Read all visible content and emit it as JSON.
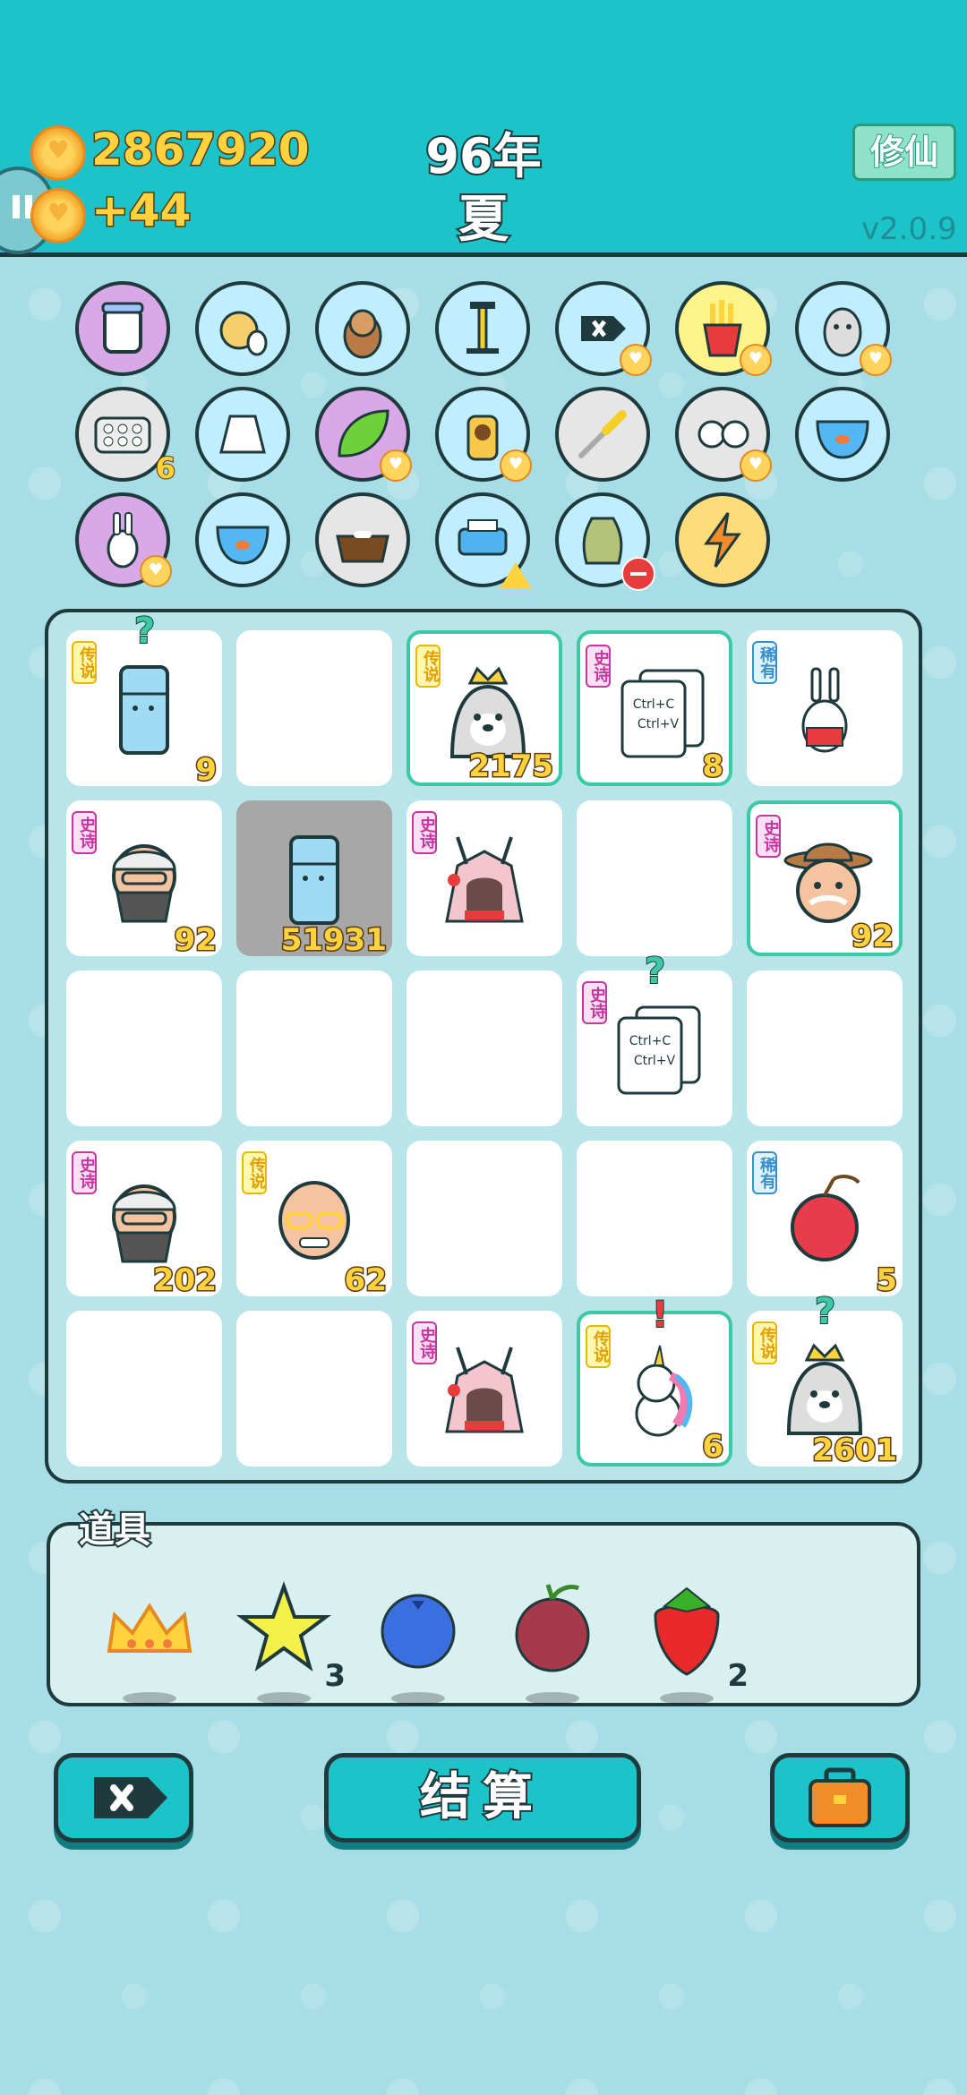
{
  "header": {
    "coins": "2867920",
    "coins_rate": "+44",
    "year": "96年",
    "season": "夏",
    "xiuxian_button": "修仙",
    "version": "v2.0.9"
  },
  "inventory_icons": [
    {
      "name": "jar-icon",
      "bg": "#d9a8e6"
    },
    {
      "name": "chick-egg-icon",
      "bg": "#bfefff"
    },
    {
      "name": "dog-icon",
      "bg": "#bfefff"
    },
    {
      "name": "air-pump-icon",
      "bg": "#bfefff"
    },
    {
      "name": "delete-tag-icon",
      "bg": "#bfefff"
    },
    {
      "name": "fries-icon",
      "bg": "#fff48a"
    },
    {
      "name": "husky-icon",
      "bg": "#bfefff"
    },
    {
      "name": "egg-tray-icon",
      "bg": "#e6e6e6",
      "count": "6"
    },
    {
      "name": "skirt-icon",
      "bg": "#bfefff"
    },
    {
      "name": "leaf-icon",
      "bg": "#d9a8e6"
    },
    {
      "name": "cat-icon",
      "bg": "#bfefff"
    },
    {
      "name": "screwdriver-icon",
      "bg": "#e6e6e6"
    },
    {
      "name": "cows-icon",
      "bg": "#e6e6e6"
    },
    {
      "name": "fish-bowl-icon",
      "bg": "#bfefff"
    },
    {
      "name": "rabbit-icon",
      "bg": "#d9a8e6"
    },
    {
      "name": "fish-bowl-icon",
      "bg": "#bfefff"
    },
    {
      "name": "pet-food-icon",
      "bg": "#e6e6e6"
    },
    {
      "name": "printer-icon",
      "bg": "#bfefff"
    },
    {
      "name": "trash-bag-icon",
      "bg": "#bfefff"
    },
    {
      "name": "lightning-icon",
      "bg": "#ffdc7a"
    }
  ],
  "board": [
    {
      "rarity": "传说",
      "type": "legend",
      "item": "fridge",
      "count": "9",
      "mark": "?"
    },
    {},
    {
      "rarity": "传说",
      "type": "legend",
      "item": "husky-crown",
      "count": "2175",
      "highlight": true
    },
    {
      "rarity": "史诗",
      "type": "epic",
      "item": "copy-paste",
      "count": "8",
      "highlight": true
    },
    {
      "rarity": "稀有",
      "type": "rare",
      "item": "rabbit-red"
    },
    {
      "rarity": "史诗",
      "type": "epic",
      "item": "old-man",
      "count": "92"
    },
    {
      "item": "fridge",
      "count": "51931",
      "dark": true
    },
    {
      "rarity": "史诗",
      "type": "epic",
      "item": "rabbit-house"
    },
    {},
    {
      "rarity": "史诗",
      "type": "epic",
      "item": "cowboy",
      "count": "92",
      "highlight": true
    },
    {},
    {},
    {},
    {
      "rarity": "史诗",
      "type": "epic",
      "item": "copy-paste",
      "mark": "?"
    },
    {},
    {
      "rarity": "史诗",
      "type": "epic",
      "item": "old-man",
      "count": "202"
    },
    {
      "rarity": "传说",
      "type": "legend",
      "item": "bald-man",
      "count": "62"
    },
    {},
    {},
    {
      "rarity": "稀有",
      "type": "rare",
      "item": "lychee",
      "count": "5"
    },
    {},
    {},
    {
      "rarity": "史诗",
      "type": "epic",
      "item": "rabbit-house"
    },
    {
      "rarity": "传说",
      "type": "legend",
      "item": "unicorn",
      "count": "6",
      "highlight": true,
      "mark": "!"
    },
    {
      "rarity": "传说",
      "type": "legend",
      "item": "husky-crown",
      "count": "2601",
      "mark": "?"
    }
  ],
  "props": {
    "title": "道具",
    "items": [
      {
        "name": "crown-icon",
        "count": ""
      },
      {
        "name": "star-icon",
        "count": "3"
      },
      {
        "name": "blueberry-icon",
        "count": ""
      },
      {
        "name": "bayberry-icon",
        "count": ""
      },
      {
        "name": "strawberry-icon",
        "count": "2"
      }
    ]
  },
  "bottom": {
    "settle_label": "结算"
  },
  "copy_paste_text": {
    "line1": "Ctrl+C",
    "line2": "Ctrl+V"
  }
}
